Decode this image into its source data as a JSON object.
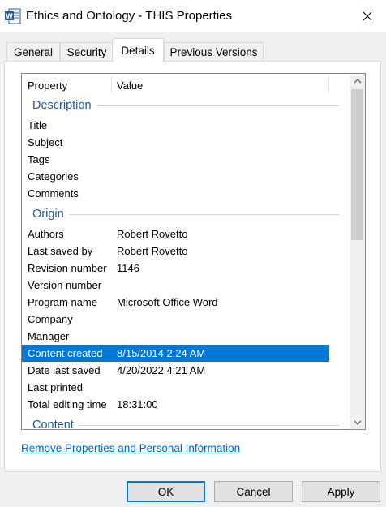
{
  "window": {
    "title": "Ethics and Ontology - THIS Properties",
    "close_icon": "close-icon"
  },
  "tabs": [
    {
      "label": "General"
    },
    {
      "label": "Security"
    },
    {
      "label": "Details",
      "active": true
    },
    {
      "label": "Previous Versions"
    }
  ],
  "list": {
    "columns": [
      "Property",
      "Value"
    ],
    "groups": [
      {
        "label": "Description",
        "rows": [
          {
            "key": "Title",
            "value": ""
          },
          {
            "key": "Subject",
            "value": ""
          },
          {
            "key": "Tags",
            "value": ""
          },
          {
            "key": "Categories",
            "value": ""
          },
          {
            "key": "Comments",
            "value": ""
          }
        ]
      },
      {
        "label": "Origin",
        "rows": [
          {
            "key": "Authors",
            "value": "Robert Rovetto"
          },
          {
            "key": "Last saved by",
            "value": "Robert Rovetto"
          },
          {
            "key": "Revision number",
            "value": "1146"
          },
          {
            "key": "Version number",
            "value": ""
          },
          {
            "key": "Program name",
            "value": "Microsoft Office Word"
          },
          {
            "key": "Company",
            "value": ""
          },
          {
            "key": "Manager",
            "value": ""
          },
          {
            "key": "Content created",
            "value": "8/15/2014 2:24 AM",
            "selected": true
          },
          {
            "key": "Date last saved",
            "value": "4/20/2022 4:21 AM"
          },
          {
            "key": "Last printed",
            "value": ""
          },
          {
            "key": "Total editing time",
            "value": "18:31:00"
          }
        ]
      },
      {
        "label": "Content",
        "rows": []
      }
    ]
  },
  "remove_link": "Remove Properties and Personal Information",
  "buttons": {
    "ok": "OK",
    "cancel": "Cancel",
    "apply": "Apply"
  },
  "colors": {
    "selection": "#0078d7",
    "group_label": "#1e5799",
    "link": "#0066cc"
  }
}
